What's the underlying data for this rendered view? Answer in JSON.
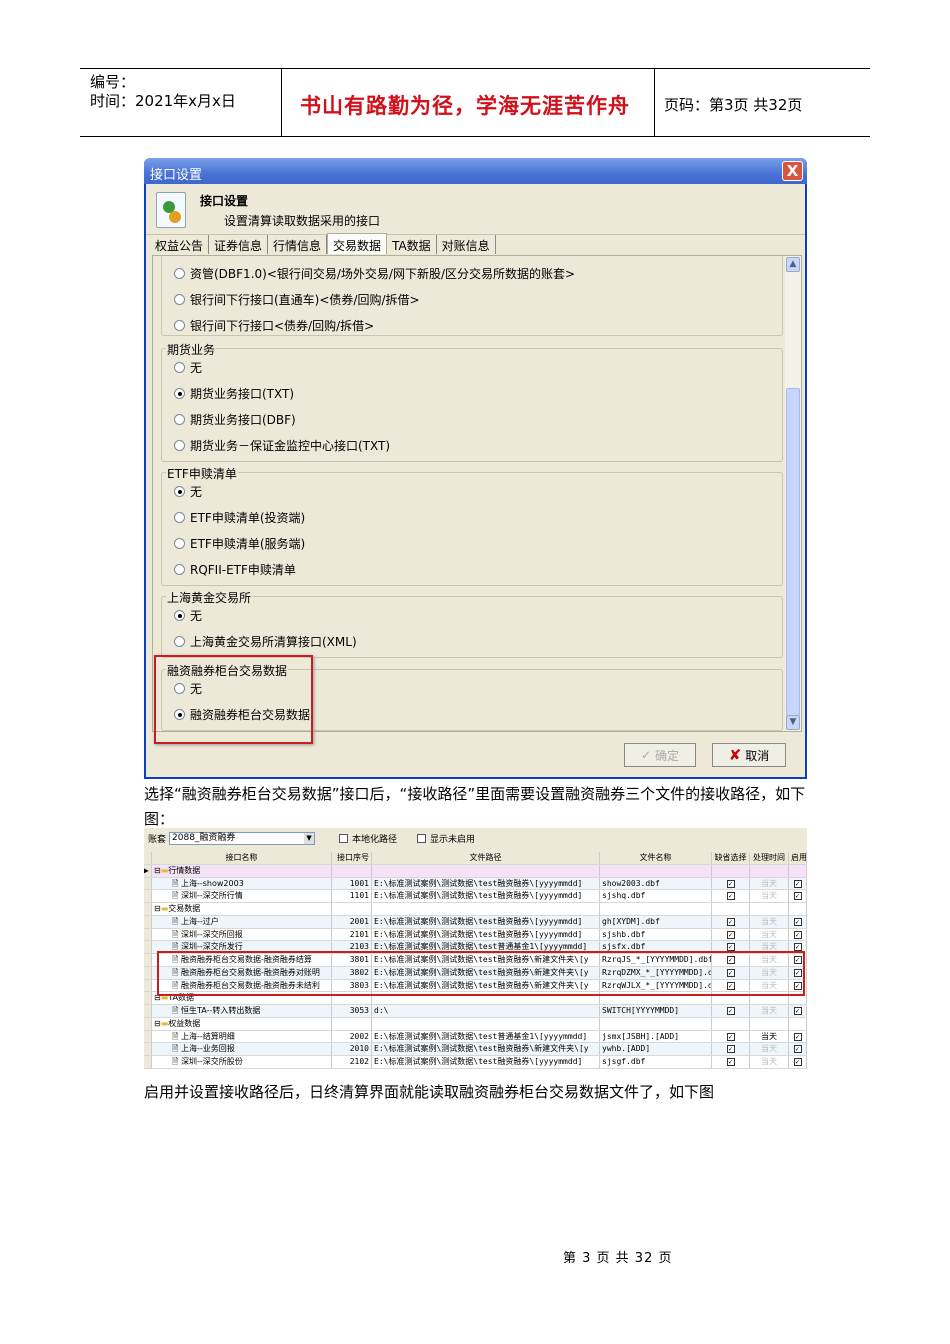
{
  "header": {
    "number_label": "编号：",
    "time_label": "时间：2021年x月x日",
    "motto": "书山有路勤为径，学海无涯苦作舟",
    "page_label": "页码：第3页  共32页"
  },
  "dialog": {
    "title": "接口设置",
    "close": "X",
    "heading": "接口设置",
    "subheading": "设置清算读取数据采用的接口",
    "tabs": [
      "权益公告",
      "证券信息",
      "行情信息",
      "交易数据",
      "TA数据",
      "对账信息"
    ],
    "active_tab": 3,
    "groups": [
      {
        "legend": "",
        "options": [
          {
            "label": "资管(DBF1.0)<银行间交易/场外交易/网下新股/区分交易所数据的账套>",
            "checked": false
          },
          {
            "label": "银行间下行接口(直通车)<债券/回购/拆借>",
            "checked": false
          },
          {
            "label": "银行间下行接口<债券/回购/拆借>",
            "checked": false
          }
        ]
      },
      {
        "legend": "期货业务",
        "options": [
          {
            "label": "无",
            "checked": false
          },
          {
            "label": "期货业务接口(TXT)",
            "checked": true
          },
          {
            "label": "期货业务接口(DBF)",
            "checked": false
          },
          {
            "label": "期货业务－保证金监控中心接口(TXT)",
            "checked": false
          }
        ]
      },
      {
        "legend": "ETF申赎清单",
        "options": [
          {
            "label": "无",
            "checked": true
          },
          {
            "label": "ETF申赎清单(投资端)",
            "checked": false
          },
          {
            "label": "ETF申赎清单(服务端)",
            "checked": false
          },
          {
            "label": "RQFII-ETF申赎清单",
            "checked": false
          }
        ]
      },
      {
        "legend": "上海黄金交易所",
        "options": [
          {
            "label": "无",
            "checked": true
          },
          {
            "label": "上海黄金交易所清算接口(XML)",
            "checked": false
          }
        ]
      },
      {
        "legend": "融资融券柜台交易数据",
        "options": [
          {
            "label": "无",
            "checked": false
          },
          {
            "label": "融资融券柜台交易数据",
            "checked": true
          }
        ]
      }
    ],
    "ok_label": "确定",
    "cancel_label": "取消"
  },
  "paragraph1": "选择“融资融券柜台交易数据”接口后，“接收路径”里面需要设置融资融券三个文件的接收路径，如下图：",
  "table_shot": {
    "account_label": "账套",
    "account_value": "2088_融资融券",
    "local_path": "本地化路径",
    "show_disabled": "显示未启用",
    "columns": [
      "接口名称",
      "接口序号",
      "文件路径",
      "文件名称",
      "缺省选择",
      "处理时间",
      "启用"
    ],
    "rows": [
      {
        "group": true,
        "name": "行情数据"
      },
      {
        "name": "上海--show2003",
        "no": "1001",
        "path": "E:\\标准测试案例\\测试数据\\test融资融券\\[yyyymmdd]",
        "file": "show2003.dbf",
        "time": "当天"
      },
      {
        "name": "深圳--深交所行情",
        "no": "1101",
        "path": "E:\\标准测试案例\\测试数据\\test融资融券\\[yyyymmdd]",
        "file": "sjshq.dbf",
        "time": "当天"
      },
      {
        "group": true,
        "name": "交易数据"
      },
      {
        "name": "上海--过户",
        "no": "2001",
        "path": "E:\\标准测试案例\\测试数据\\test融资融券\\[yyyymmdd]",
        "file": "gh[XYDM].dbf",
        "time": "当天"
      },
      {
        "name": "深圳--深交所回报",
        "no": "2101",
        "path": "E:\\标准测试案例\\测试数据\\test融资融券\\[yyyymmdd]",
        "file": "sjshb.dbf",
        "time": "当天"
      },
      {
        "name": "深圳--深交所发行",
        "no": "2103",
        "path": "E:\\标准测试案例\\测试数据\\test普通基金1\\[yyyymmdd]",
        "file": "sjsfx.dbf",
        "time": "当天"
      },
      {
        "name": "融资融券柜台交易数据-融资融券结算",
        "no": "3801",
        "path": "E:\\标准测试案例\\测试数据\\test融资融券\\新建文件夹\\[y",
        "file": "RzrqJS_*_[YYYYMMDD].dbf",
        "time": "当天"
      },
      {
        "name": "融资融券柜台交易数据-融资融券对账明",
        "no": "3802",
        "path": "E:\\标准测试案例\\测试数据\\test融资融券\\新建文件夹\\[y",
        "file": "RzrqDZMX_*_[YYYYMMDD].dbf",
        "time": "当天"
      },
      {
        "name": "融资融券柜台交易数据-融资融券未结利",
        "no": "3803",
        "path": "E:\\标准测试案例\\测试数据\\test融资融券\\新建文件夹\\[y",
        "file": "RzrqWJLX_*_[YYYYMMDD].dbf",
        "time": "当天"
      },
      {
        "group": true,
        "name": "TA数据"
      },
      {
        "name": "恒生TA--转入转出数据",
        "no": "3053",
        "path": "d:\\",
        "file": "SWITCH[YYYYMMDD]",
        "time": "当天"
      },
      {
        "group": true,
        "name": "权益数据"
      },
      {
        "name": "上海--结算明细",
        "no": "2002",
        "path": "E:\\标准测试案例\\测试数据\\test普通基金1\\[yyyymmdd]",
        "file": "jsmx[JSBH].[ADD]",
        "time": "当天",
        "time_active": true
      },
      {
        "name": "上海--业务回报",
        "no": "2010",
        "path": "E:\\标准测试案例\\测试数据\\test融资融券\\新建文件夹\\[y",
        "file": "ywhb.[ADD]",
        "time": "当天"
      },
      {
        "name": "深圳--深交所股份",
        "no": "2102",
        "path": "E:\\标准测试案例\\测试数据\\test融资融券\\[yyyymmdd]",
        "file": "sjsgf.dbf",
        "time": "当天"
      }
    ]
  },
  "paragraph2": "启用并设置接收路径后，日终清算界面就能读取融资融券柜台交易数据文件了，如下图",
  "footer": "第 3 页 共 32 页"
}
